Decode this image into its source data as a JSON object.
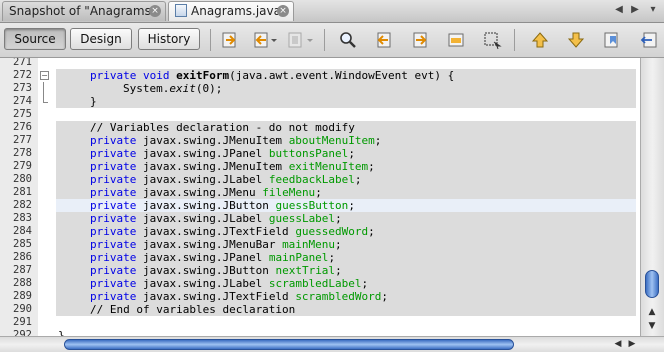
{
  "tabs": [
    {
      "label": "Snapshot of \"Anagrams\"",
      "close": "×"
    },
    {
      "label": "Anagrams.java",
      "close": "×"
    }
  ],
  "tab_controls": {
    "scroll_left": "◀",
    "scroll_right": "▶",
    "list": "▾"
  },
  "toolbar": {
    "source_label": "Source",
    "design_label": "Design",
    "history_label": "History"
  },
  "editor": {
    "lines": [
      {
        "num": "271"
      },
      {
        "num": "272"
      },
      {
        "num": "273"
      },
      {
        "num": "274"
      },
      {
        "num": "275"
      },
      {
        "num": "276",
        "text": "// Variables declaration - do not modify"
      },
      {
        "num": "277",
        "type": "javax.swing.JMenuItem",
        "name": "aboutMenuItem"
      },
      {
        "num": "278",
        "type": "javax.swing.JPanel",
        "name": "buttonsPanel"
      },
      {
        "num": "279",
        "type": "javax.swing.JMenuItem",
        "name": "exitMenuItem"
      },
      {
        "num": "280",
        "type": "javax.swing.JLabel",
        "name": "feedbackLabel"
      },
      {
        "num": "281",
        "type": "javax.swing.JMenu",
        "name": "fileMenu"
      },
      {
        "num": "282",
        "type": "javax.swing.JButton",
        "name": "guessButton"
      },
      {
        "num": "283",
        "type": "javax.swing.JLabel",
        "name": "guessLabel"
      },
      {
        "num": "284",
        "type": "javax.swing.JTextField",
        "name": "guessedWord"
      },
      {
        "num": "285",
        "type": "javax.swing.JMenuBar",
        "name": "mainMenu"
      },
      {
        "num": "286",
        "type": "javax.swing.JPanel",
        "name": "mainPanel"
      },
      {
        "num": "287",
        "type": "javax.swing.JButton",
        "name": "nextTrial"
      },
      {
        "num": "288",
        "type": "javax.swing.JLabel",
        "name": "scrambledLabel"
      },
      {
        "num": "289",
        "type": "javax.swing.JTextField",
        "name": "scrambledWord"
      },
      {
        "num": "290",
        "text": "// End of variables declaration"
      },
      {
        "num": "291"
      },
      {
        "num": "292",
        "text": "}"
      }
    ],
    "line272": {
      "kw1": "private",
      "kw2": "void",
      "method": "exitForm",
      "params": "(java.awt.event.WindowEvent evt) {"
    },
    "line273": {
      "prefix": "System.",
      "call": "exit",
      "suffix": "(0);"
    },
    "line274": "}",
    "private_kw": "private",
    "semicolon": ";"
  },
  "scrollbars": {
    "up": "▲",
    "down": "▼",
    "left": "◀",
    "right": "▶"
  },
  "colors": {
    "keyword": "#0000e6",
    "field": "#009900",
    "comment": "#969696",
    "guarded_block": "#dcdcdc",
    "caret_line": "#e9eff8",
    "scroll_thumb": "#3d6fc3"
  }
}
